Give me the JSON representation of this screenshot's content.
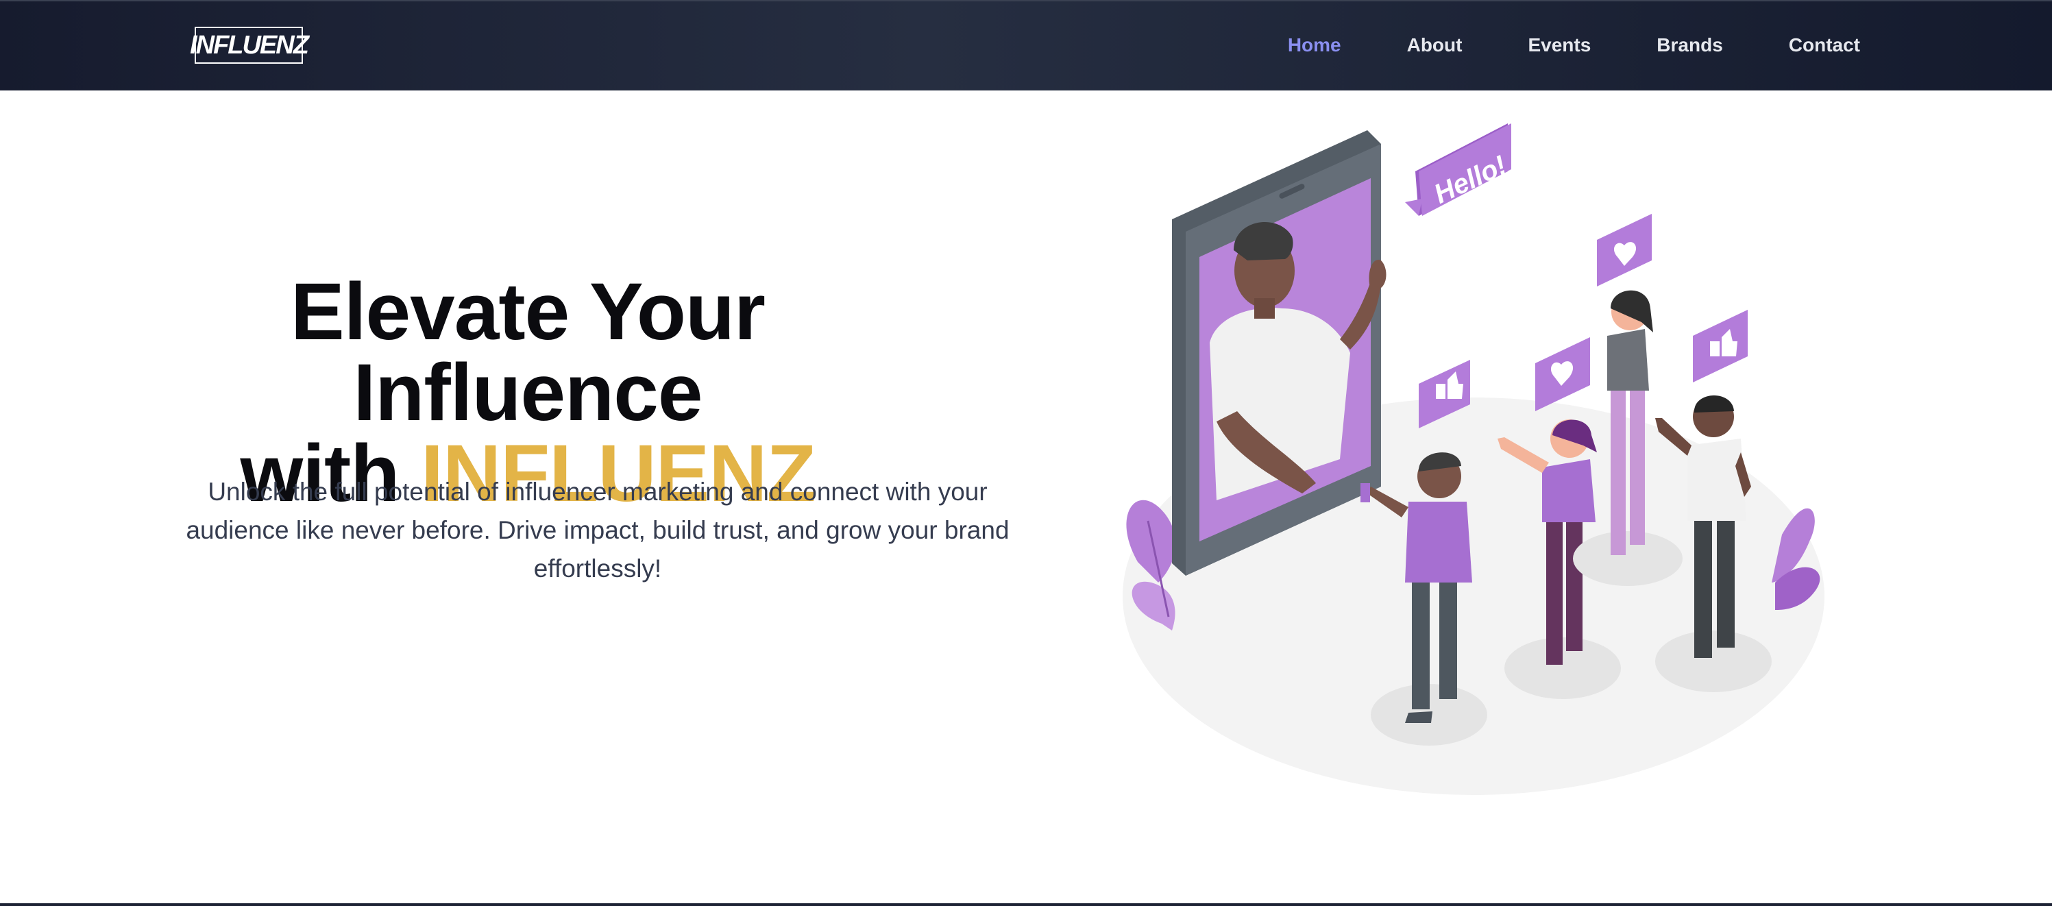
{
  "brand": {
    "logo_text": "INFLUENZ"
  },
  "nav": {
    "items": [
      {
        "label": "Home",
        "active": true
      },
      {
        "label": "About",
        "active": false
      },
      {
        "label": "Events",
        "active": false
      },
      {
        "label": "Brands",
        "active": false
      },
      {
        "label": "Contact",
        "active": false
      }
    ]
  },
  "hero": {
    "title_line1": "Elevate Your Influence",
    "title_with": "with ",
    "title_accent": "INFLUENZ",
    "subtitle": "Unlock the full potential of influencer marketing and connect with your audience like never before. Drive impact, build trust, and grow your brand effortlessly!"
  },
  "illustration": {
    "speech_bubble_text": "Hello!"
  },
  "colors": {
    "nav_bg": "#1e2436",
    "nav_active": "#8a8ff0",
    "accent": "#e3b447",
    "illustration_purple": "#a66fd1"
  }
}
